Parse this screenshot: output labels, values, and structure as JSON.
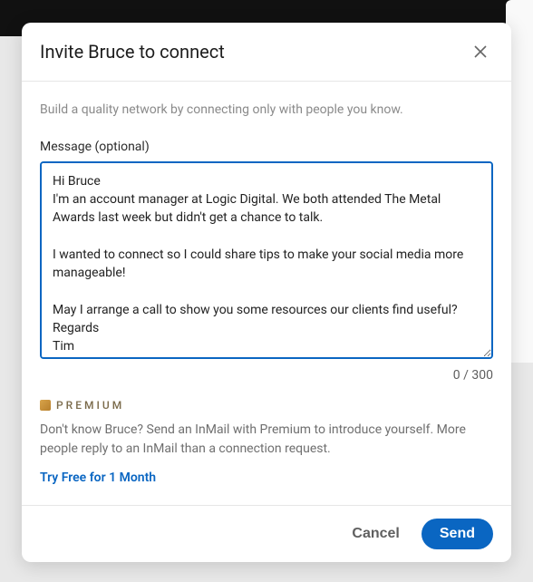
{
  "modal": {
    "title": "Invite Bruce to connect",
    "subtitle": "Build a quality network by connecting only with people you know.",
    "message_label": "Message (optional)",
    "message_value": "Hi Bruce\nI'm an account manager at Logic Digital. We both attended The Metal Awards last week but didn't get a chance to talk.\n\nI wanted to connect so I could share tips to make your social media more manageable!\n\nMay I arrange a call to show you some resources our clients find useful?\nRegards\nTim",
    "char_count": "0 / 300",
    "premium": {
      "label": "PREMIUM",
      "text": "Don't know Bruce? Send an InMail with Premium to introduce yourself. More people reply to an InMail than a connection request.",
      "link": "Try Free for 1 Month"
    },
    "footer": {
      "cancel": "Cancel",
      "send": "Send"
    }
  }
}
